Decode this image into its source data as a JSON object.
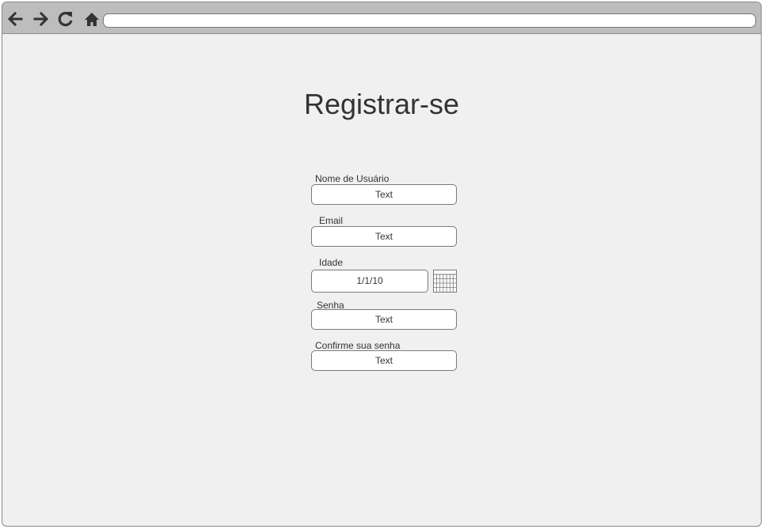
{
  "browser": {
    "address": "",
    "nav_icons": [
      "back-arrow-icon",
      "forward-arrow-icon",
      "refresh-icon",
      "home-icon"
    ]
  },
  "page": {
    "title": "Registrar-se"
  },
  "form": {
    "username": {
      "label": "Nome de Usuário",
      "value": "Text"
    },
    "email": {
      "label": "Email",
      "value": "Text"
    },
    "age": {
      "label": "Idade",
      "value": "1/1/10",
      "icon": "calendar-icon"
    },
    "password": {
      "label": "Senha",
      "value": "Text"
    },
    "confirm_password": {
      "label": "Confirme sua senha",
      "value": "Text"
    }
  },
  "colors": {
    "page_background": "#eff0ef",
    "toolbar_background": "#bdbdbd",
    "text": "#333333",
    "border": "#7a7a7a"
  }
}
